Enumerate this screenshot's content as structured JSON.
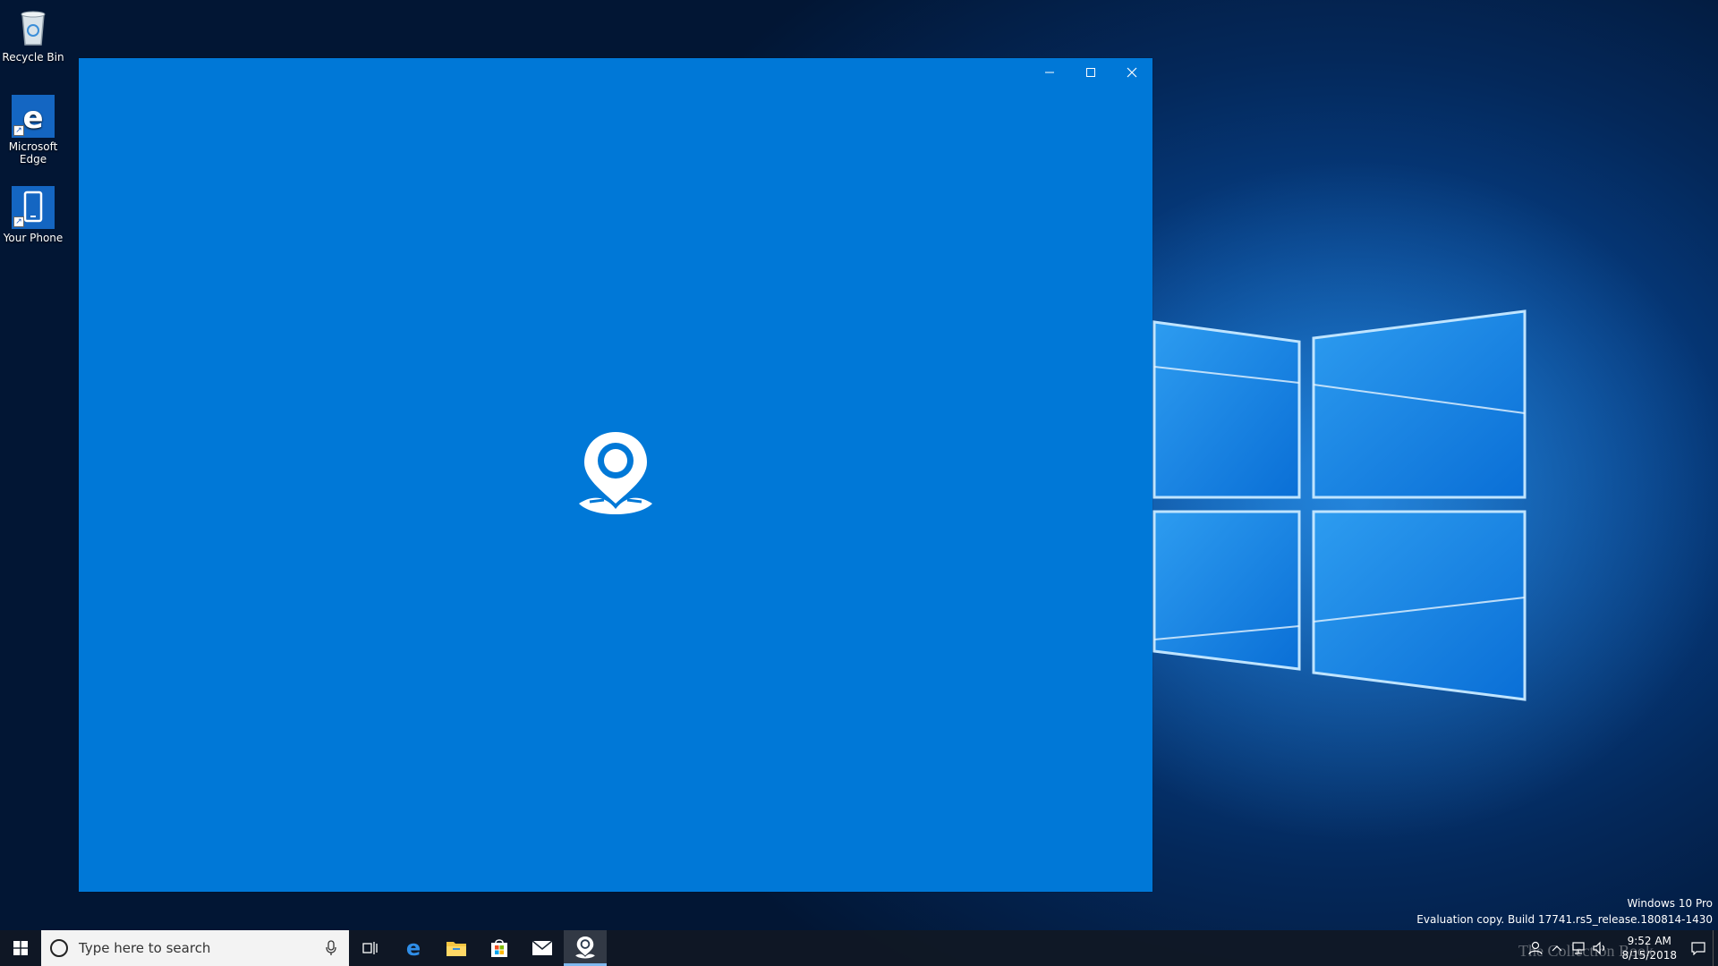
{
  "desktop": {
    "icons": [
      {
        "label": "Recycle Bin"
      },
      {
        "label": "Microsoft Edge"
      },
      {
        "label": "Your Phone"
      }
    ]
  },
  "window": {
    "background_color": "#0078d7",
    "logo": "your-phone-pin-icon",
    "caption": {
      "minimize_icon": "minimize-icon",
      "maximize_icon": "maximize-icon",
      "close_icon": "close-icon"
    }
  },
  "watermark": {
    "edition": "Windows 10 Pro",
    "build": "Evaluation copy. Build 17741.rs5_release.180814-1430"
  },
  "taskbar": {
    "search_placeholder": "Type here to search",
    "pinned": [
      "task-view-icon",
      "edge-icon",
      "file-explorer-icon",
      "store-icon",
      "mail-icon",
      "your-phone-icon"
    ],
    "clock": {
      "time": "9:52 AM",
      "date": "8/15/2018"
    }
  },
  "overlay_text": "The Collection Book"
}
